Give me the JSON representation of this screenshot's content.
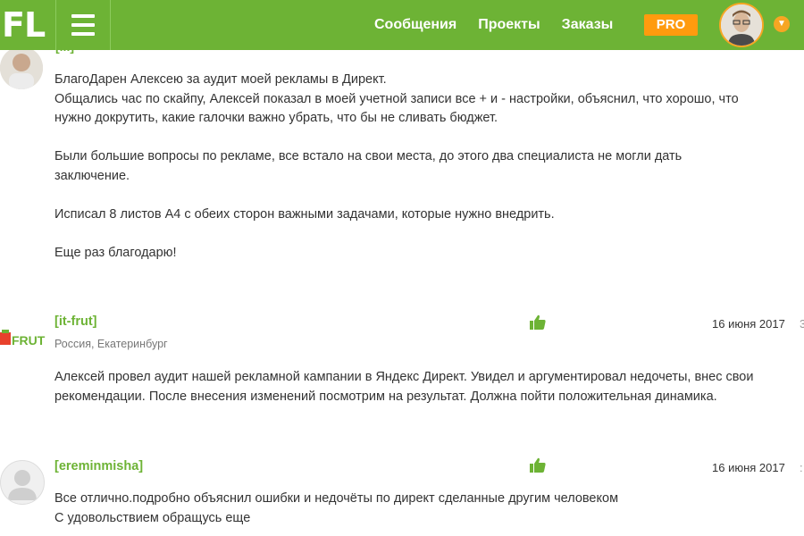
{
  "header": {
    "logo": "FL",
    "nav": [
      "Сообщения",
      "Проекты",
      "Заказы"
    ],
    "pro_label": "PRO",
    "accent_color": "#6db335",
    "pro_color": "#ff9b0e"
  },
  "reviews": [
    {
      "lines": [
        "БлагоДарен Алексею за аудит моей рекламы в Директ.",
        "Общались час по скайпу, Алексей показал в моей учетной записи все + и - настройки, объяснил, что хорошо, что",
        "нужно докрутить, какие галочки важно убрать, что бы не сливать бюджет.",
        "",
        "Были большие вопросы по рекламе, все встало на свои места, до этого два специалиста не могли дать",
        "заключение.",
        "",
        "Исписал 8 листов А4 с обеих сторон важными задачами, которые нужно внедрить.",
        "",
        "Еще раз благодарю!"
      ]
    },
    {
      "username": "[it-frut]",
      "location": "Россия, Екатеринбург",
      "date": "16 июня 2017",
      "logo_text": "FRUT",
      "lines": [
        "Алексей провел аудит нашей рекламной кампании в Яндекс Директ. Увидел и аргументировал недочеты, внес свои",
        "рекомендации. После внесения изменений посмотрим на результат. Должна пойти положительная динамика."
      ]
    },
    {
      "username": "[ereminmisha]",
      "date": "16 июня 2017",
      "lines": [
        "Все отлично.подробно объяснил ошибки и недочёты по директ сделанные другим человеком",
        "С удовольствием обращусь еще"
      ]
    }
  ]
}
